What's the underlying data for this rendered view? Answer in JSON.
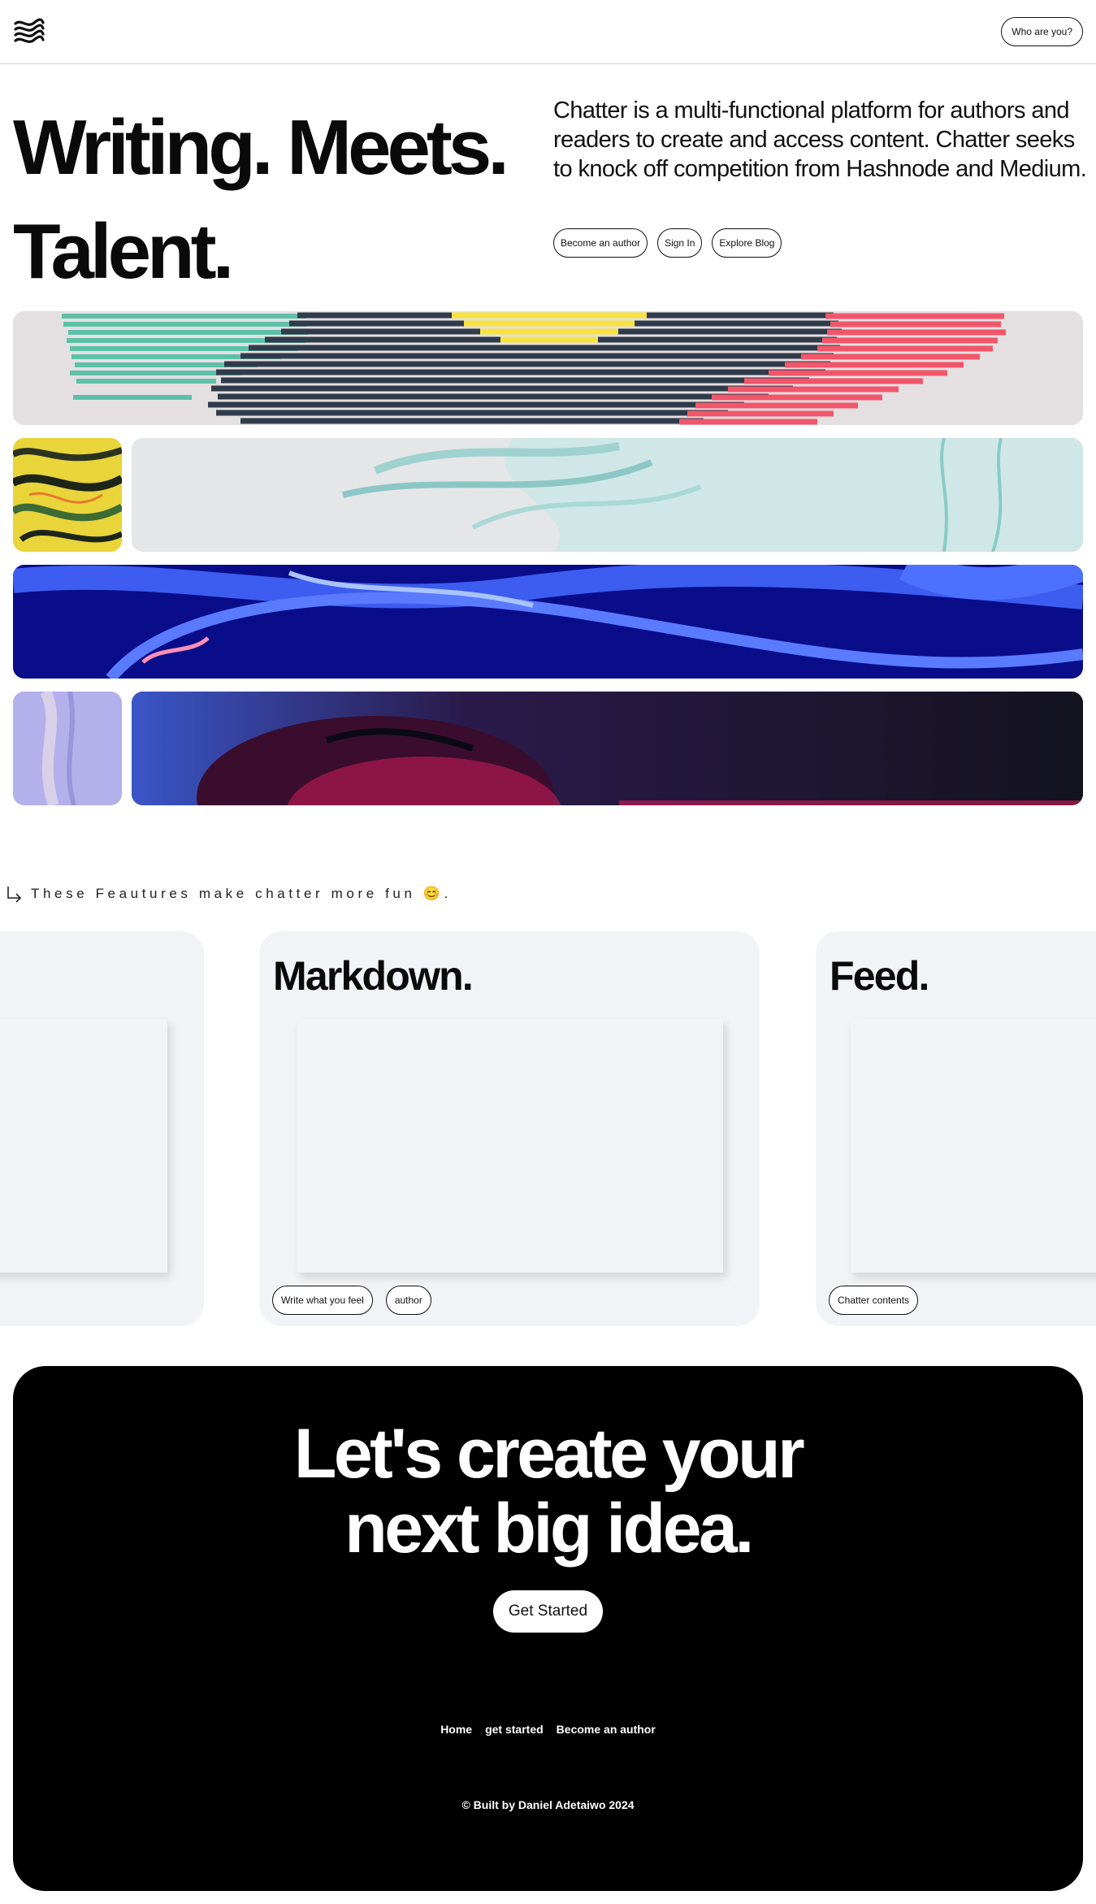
{
  "header": {
    "logo_icon": "wave-lines-logo-icon",
    "who_button_label": "Who are you?"
  },
  "hero": {
    "title_line1": "Writing. Meets.",
    "title_line2": "Talent.",
    "description": "Chatter is a multi-functional platform for authors and readers to create and access content. Chatter seeks to knock off competition from Hashnode and Medium.",
    "buttons": [
      {
        "label": "Become an author"
      },
      {
        "label": "Sign In"
      },
      {
        "label": "Explore Blog"
      }
    ]
  },
  "gallery": {
    "colors": {
      "teal": "#5cc1a6",
      "navy": "#2f3b4a",
      "yellow": "#f7e33a",
      "coral": "#f2566a",
      "mint": "#cfe7e6",
      "cobalt": "#0a0d8a",
      "lavender": "#b3b0ec",
      "ink": "#14131f",
      "magenta": "#d11d5a"
    }
  },
  "features": {
    "arrow_icon": "arrow-down-right-icon",
    "intro": "These Feautures make chatter more fun 😊.",
    "cards": [
      {
        "title": "",
        "tags": []
      },
      {
        "title": "Markdown.",
        "tags": [
          "Write what you feel",
          "author"
        ]
      },
      {
        "title": "Feed.",
        "tags": [
          "Chatter contents"
        ]
      }
    ]
  },
  "cta": {
    "title_line1": "Let's create your",
    "title_line2": "next big idea.",
    "button_label": "Get Started",
    "links": [
      "Home",
      "get started",
      "Become an author"
    ],
    "copyright": "© Built by Daniel Adetaiwo 2024"
  }
}
